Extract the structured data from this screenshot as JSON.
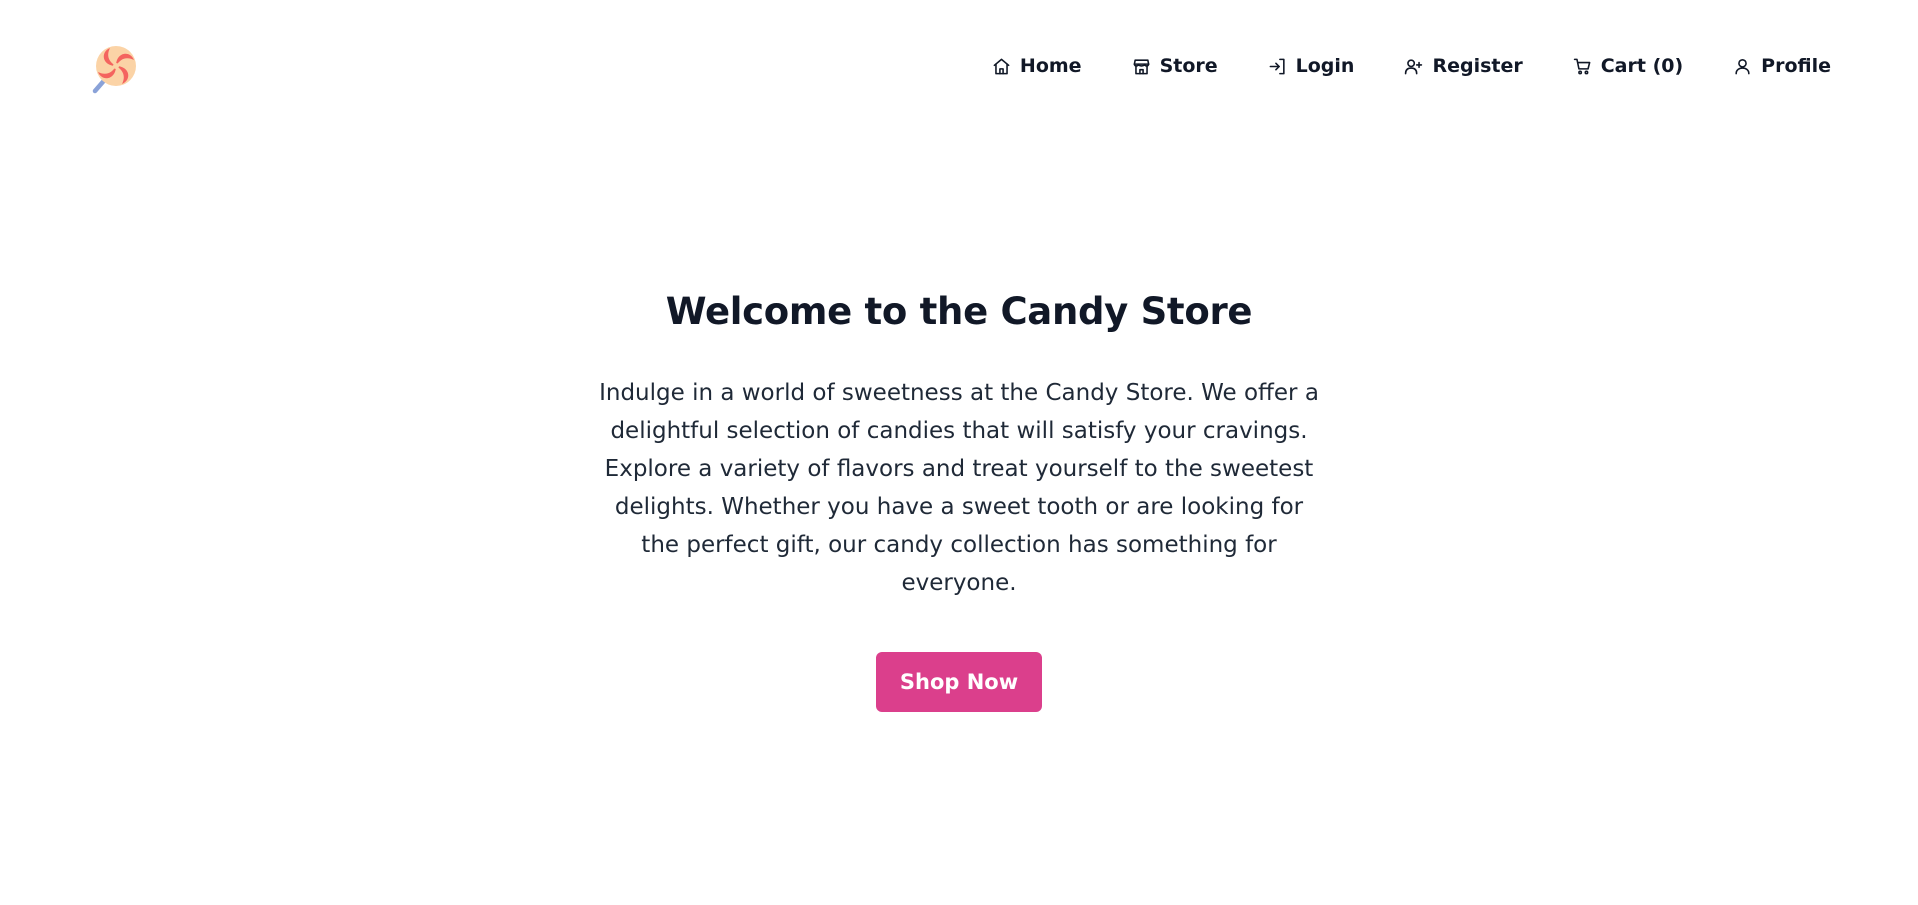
{
  "logo": {
    "icon": "lollipop-icon"
  },
  "nav": {
    "items": [
      {
        "label": "Home",
        "icon": "home-icon"
      },
      {
        "label": "Store",
        "icon": "store-icon"
      },
      {
        "label": "Login",
        "icon": "login-icon"
      },
      {
        "label": "Register",
        "icon": "register-icon"
      },
      {
        "label": "Cart (0)",
        "icon": "cart-icon"
      },
      {
        "label": "Profile",
        "icon": "profile-icon"
      }
    ]
  },
  "hero": {
    "title": "Welcome to the Candy Store",
    "description": "Indulge in a world of sweetness at the Candy Store. We offer a delightful selection of candies that will satisfy your cravings. Explore a variety of flavors and treat yourself to the sweetest delights. Whether you have a sweet tooth or are looking for the perfect gift, our candy collection has something for everyone.",
    "button_label": "Shop Now"
  },
  "colors": {
    "accent": "#db3f8c",
    "text": "#111827",
    "background": "#ffffff"
  }
}
